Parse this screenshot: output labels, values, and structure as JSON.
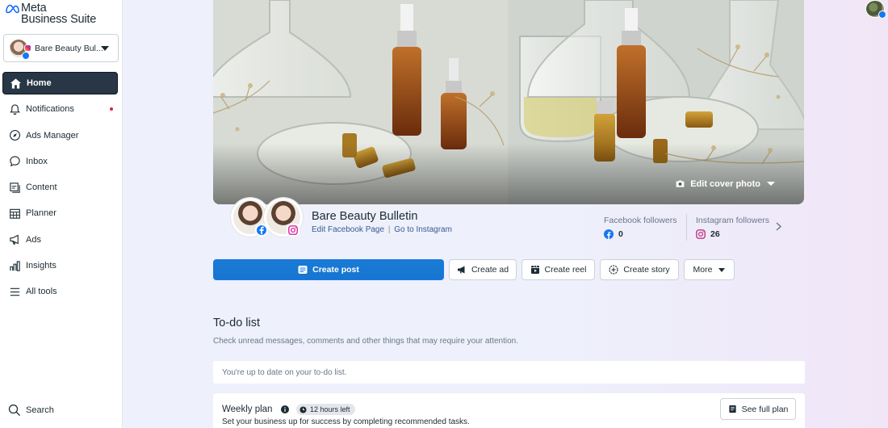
{
  "logo": {
    "line1": "Meta",
    "line2": "Business Suite"
  },
  "account": {
    "name": "Bare Beauty Bul..."
  },
  "nav": [
    {
      "label": "Home"
    },
    {
      "label": "Notifications"
    },
    {
      "label": "Ads Manager"
    },
    {
      "label": "Inbox"
    },
    {
      "label": "Content"
    },
    {
      "label": "Planner"
    },
    {
      "label": "Ads"
    },
    {
      "label": "Insights"
    },
    {
      "label": "All tools"
    }
  ],
  "search_label": "Search",
  "cover": {
    "edit_label": "Edit cover photo"
  },
  "page": {
    "name": "Bare Beauty Bulletin",
    "edit_fb_link": "Edit Facebook Page",
    "separator": "|",
    "go_ig_link": "Go to Instagram"
  },
  "stats": {
    "fb_label": "Facebook followers",
    "fb_value": "0",
    "ig_label": "Instagram followers",
    "ig_value": "26"
  },
  "actions": {
    "create_post": "Create post",
    "create_ad": "Create ad",
    "create_reel": "Create reel",
    "create_story": "Create story",
    "more": "More"
  },
  "todo": {
    "title": "To-do list",
    "subtitle": "Check unread messages, comments and other things that may require your attention.",
    "empty_text": "You're up to date on your to-do list."
  },
  "weekly": {
    "title": "Weekly plan",
    "time_left": "12 hours left",
    "subtitle": "Set your business up for success by completing recommended tasks.",
    "see_plan": "See full plan"
  },
  "colors": {
    "accent": "#1877f2",
    "active_nav": "#283645",
    "notification_dot": "#e41e3f"
  }
}
